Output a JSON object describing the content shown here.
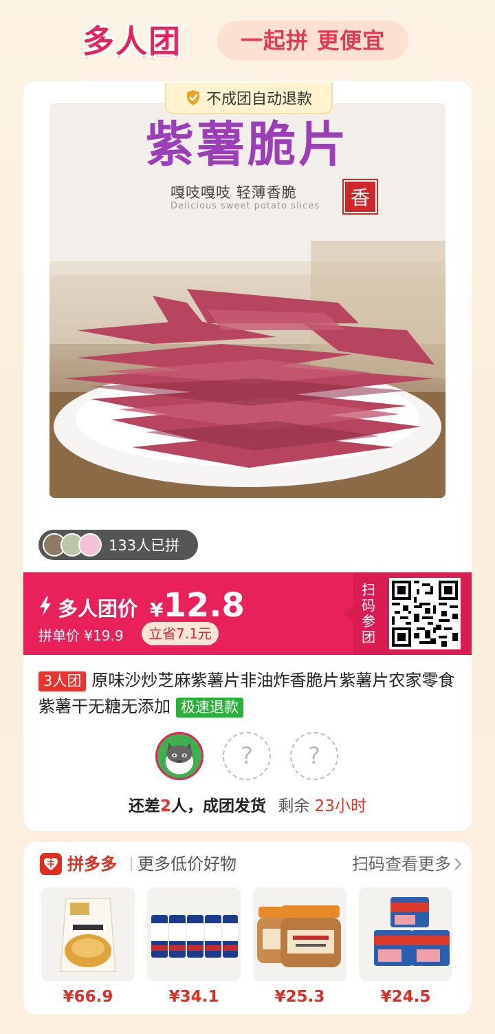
{
  "header": {
    "brand": "多人团",
    "slogan": "一起拼 更便宜"
  },
  "product": {
    "guarantee": "不成团自动退款",
    "image_title": "紫薯脆片",
    "image_subtitle": "嘎吱嘎吱 轻薄香脆",
    "image_english": "Delicious sweet potato slices",
    "image_stamp": "香",
    "joined_count": "133人已拼",
    "price_label": "多人团价",
    "currency": "¥",
    "group_price": "12.8",
    "single_price": "拼单价 ¥19.9",
    "save": "立省7.1元",
    "scan_label": "扫码参团",
    "group_size_tag": "3人团",
    "title": "原味沙炒芝麻紫薯片非油炸香脆片紫薯片农家零食紫薯干无糖无添加",
    "refund_tag": "极速退款",
    "empty_slot": "?",
    "status": {
      "prefix": "还差",
      "count": "2",
      "suffix": "人，成团发货",
      "remain_label": "剩余",
      "remain_time": "23小时"
    }
  },
  "recommend": {
    "brand": "拼多多",
    "subtitle": "更多低价好物",
    "more": "扫码查看更多",
    "items": [
      {
        "price": "¥66.9",
        "icon": "rice-bag-icon"
      },
      {
        "price": "¥34.1",
        "icon": "beer-cans-icon"
      },
      {
        "price": "¥25.3",
        "icon": "sauce-jars-icon"
      },
      {
        "price": "¥24.5",
        "icon": "luncheon-meat-icon"
      }
    ]
  },
  "colors": {
    "accent": "#e8215b",
    "price_red": "#e02e24",
    "refund_green": "#2bb13b"
  }
}
